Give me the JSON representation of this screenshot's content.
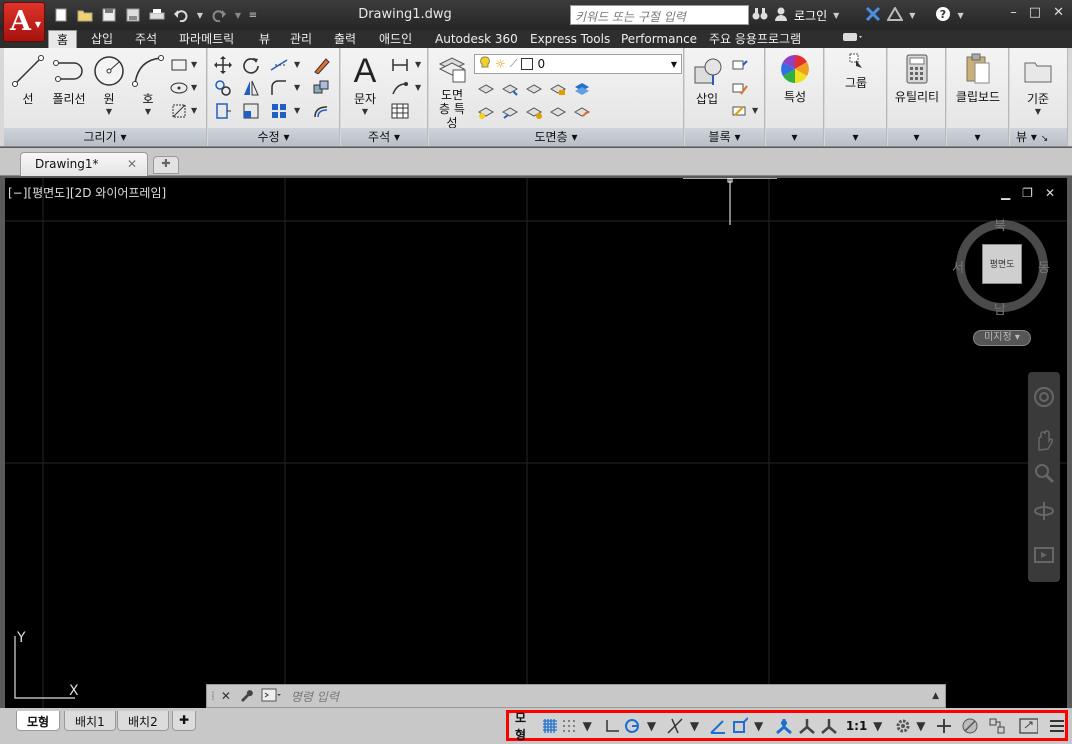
{
  "window": {
    "title": "Drawing1.dwg",
    "search_placeholder": "키워드 또는 구절 입력",
    "login_label": "로그인"
  },
  "ribbon": {
    "tabs": [
      "홈",
      "삽입",
      "주석",
      "파라메트릭",
      "뷰",
      "관리",
      "출력",
      "애드인",
      "Autodesk 360",
      "Express Tools",
      "Performance",
      "주요 응용프로그램"
    ],
    "active_tab": "홈",
    "panels": {
      "draw": {
        "title": "그리기",
        "tools": [
          "선",
          "폴리선",
          "원",
          "호"
        ]
      },
      "modify": {
        "title": "수정"
      },
      "annotation": {
        "title": "주석",
        "tools": [
          "문자"
        ]
      },
      "layers": {
        "title": "도면층",
        "tools": [
          "도면층 특성"
        ],
        "current_layer": "0"
      },
      "block": {
        "title": "블록",
        "tools": [
          "삽입"
        ]
      },
      "properties": {
        "tools": [
          "특성"
        ]
      },
      "groups": {
        "tools": [
          "그룹"
        ]
      },
      "utilities": {
        "tools": [
          "유틸리티"
        ]
      },
      "clipboard": {
        "tools": [
          "클립보드"
        ]
      },
      "view": {
        "title": "뷰",
        "tools": [
          "기준"
        ]
      }
    }
  },
  "documents": {
    "tabs": [
      "Drawing1*"
    ]
  },
  "viewport": {
    "label": "[−][평면도][2D 와이어프레임]",
    "viewcube": {
      "north": "북",
      "south": "남",
      "east": "동",
      "west": "서",
      "face": "평면도",
      "wcs": "미지정"
    },
    "ucs": {
      "x": "X",
      "y": "Y"
    }
  },
  "command_line": {
    "placeholder": "명령 입력"
  },
  "layout_tabs": [
    "모형",
    "배치1",
    "배치2"
  ],
  "statusbar": {
    "model_label": "모형",
    "scale": "1:1"
  }
}
